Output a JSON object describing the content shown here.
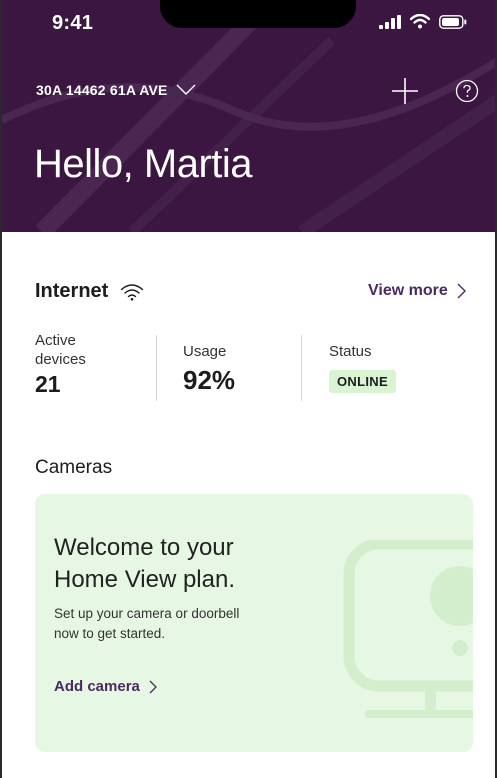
{
  "status_bar": {
    "time": "9:41"
  },
  "header": {
    "address": "30A 14462 61A AVE",
    "greeting": "Hello, Martia"
  },
  "internet": {
    "title": "Internet",
    "view_more": "View more",
    "stats": {
      "active_devices_label_line1": "Active",
      "active_devices_label_line2": "devices",
      "active_devices_value": "21",
      "usage_label": "Usage",
      "usage_value": "92%",
      "status_label": "Status",
      "status_value": "ONLINE"
    }
  },
  "cameras": {
    "title": "Cameras",
    "card": {
      "heading_line1": "Welcome to your",
      "heading_line2": "Home View plan.",
      "text_line1": "Set up your camera or doorbell",
      "text_line2": "now to get started.",
      "link": "Add camera"
    }
  },
  "colors": {
    "header_bg": "#3a1640",
    "accent": "#4b2a63",
    "online_badge_bg": "#d9f3d3",
    "card_bg": "#e6f8e3"
  },
  "icons": [
    "signal-bars-icon",
    "wifi-icon",
    "battery-icon",
    "chevron-down-icon",
    "plus-icon",
    "help-icon",
    "chevron-right-icon",
    "camera-illustration-icon"
  ]
}
